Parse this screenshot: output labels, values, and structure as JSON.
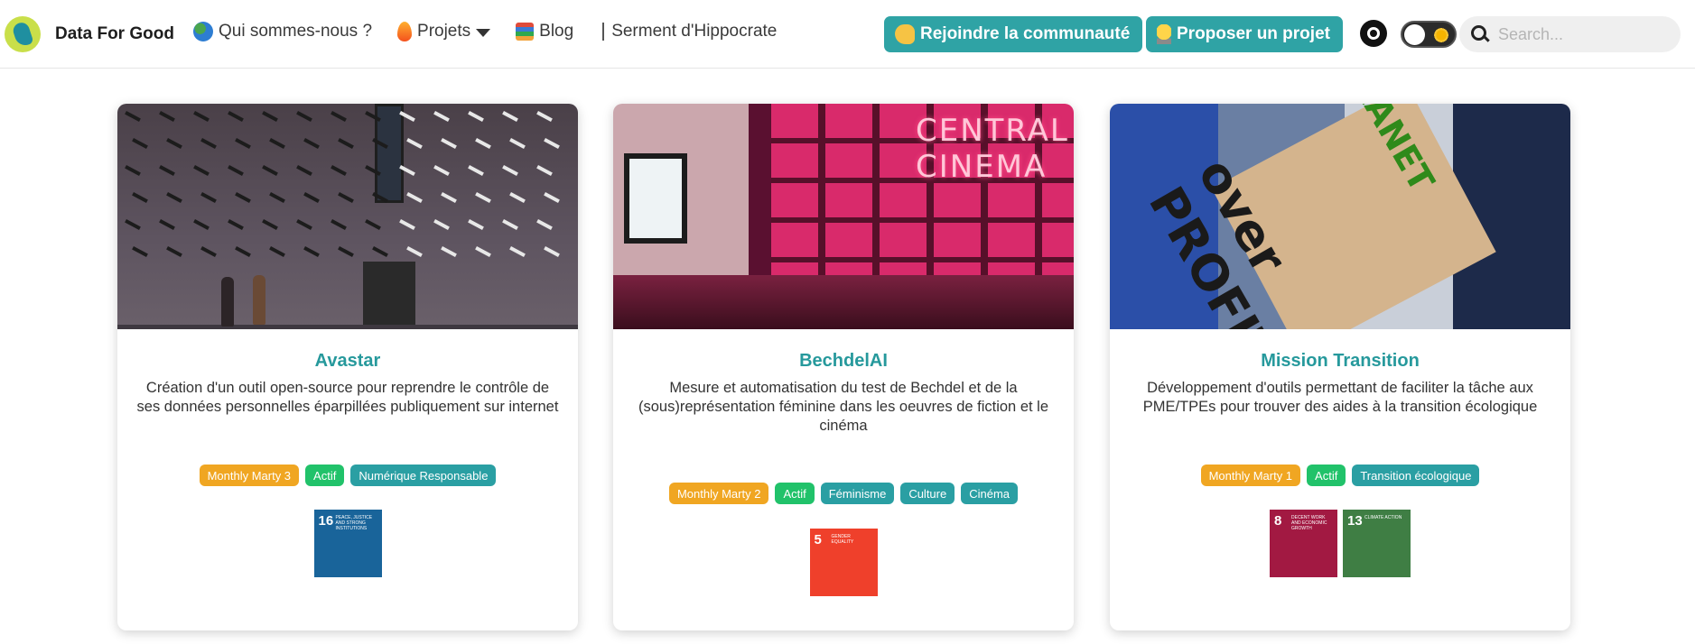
{
  "navbar": {
    "brand": "Data For Good",
    "links": [
      {
        "label": "Qui sommes-nous ?",
        "icon": "globe-icon"
      },
      {
        "label": "Projets",
        "icon": "fire-icon",
        "dropdown": true
      },
      {
        "label": "Blog",
        "icon": "books-icon"
      },
      {
        "label": "Serment d'Hippocrate",
        "icon": "medical-staff-icon"
      }
    ],
    "join_button": "Rejoindre la communauté",
    "propose_button": "Proposer un projet",
    "search_placeholder": "Search..."
  },
  "projects": [
    {
      "title": "Avastar",
      "description": "Création d'un outil open-source pour reprendre le contrôle de ses données personnelles éparpillées publiquement sur internet",
      "tags": [
        {
          "label": "Monthly Marty 3",
          "color": "orange"
        },
        {
          "label": "Actif",
          "color": "green"
        },
        {
          "label": "Numérique Responsable",
          "color": "teal"
        }
      ],
      "sdgs": [
        {
          "number": "16",
          "label": "Peace, Justice and Strong Institutions",
          "color": "#19649a"
        }
      ]
    },
    {
      "title": "BechdelAI",
      "description": "Mesure et automatisation du test de Bechdel et de la (sous)représentation féminine dans les oeuvres de fiction et le cinéma",
      "tags": [
        {
          "label": "Monthly Marty 2",
          "color": "orange"
        },
        {
          "label": "Actif",
          "color": "green"
        },
        {
          "label": "Féminisme",
          "color": "teal"
        },
        {
          "label": "Culture",
          "color": "teal"
        },
        {
          "label": "Cinéma",
          "color": "teal"
        }
      ],
      "sdgs": [
        {
          "number": "5",
          "label": "Gender Equality",
          "color": "#ef402b"
        }
      ],
      "image_sign": "CENTRAL CINEMA"
    },
    {
      "title": "Mission Transition",
      "description": "Développement d'outils permettant de faciliter la tâche aux PME/TPEs pour trouver des aides à la transition écologique",
      "tags": [
        {
          "label": "Monthly Marty 1",
          "color": "orange"
        },
        {
          "label": "Actif",
          "color": "green"
        },
        {
          "label": "Transition écologique",
          "color": "teal"
        }
      ],
      "sdgs": [
        {
          "number": "8",
          "label": "Decent Work and Economic Growth",
          "color": "#a21942"
        },
        {
          "number": "13",
          "label": "Climate Action",
          "color": "#3f7e44"
        }
      ],
      "image_sign": [
        "PLANET",
        "over PROFIT"
      ]
    }
  ]
}
